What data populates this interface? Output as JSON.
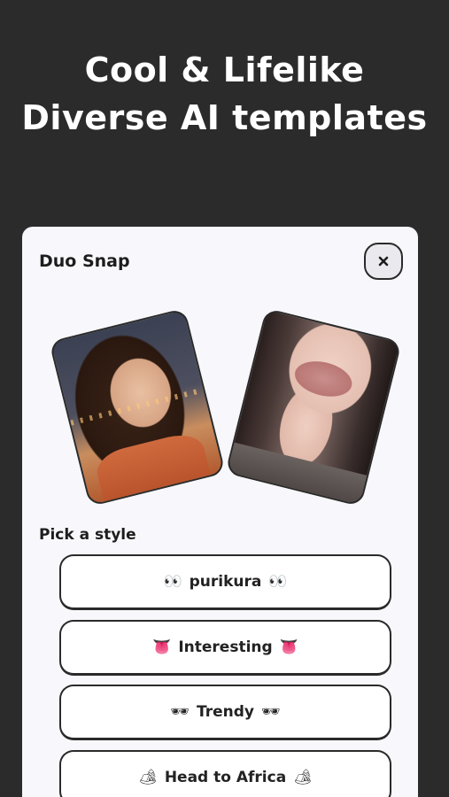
{
  "headline": {
    "line1": "Cool & Lifelike",
    "line2": "Diverse AI templates"
  },
  "sheet": {
    "title": "Duo Snap",
    "close_icon": "close-icon",
    "photos": [
      {
        "description_icon": "portrait-photo",
        "name": "photo-left"
      },
      {
        "description_icon": "portrait-photo",
        "name": "photo-right"
      }
    ],
    "section_label": "Pick a style",
    "styles": [
      {
        "emoji": "👀",
        "label": "purikura"
      },
      {
        "emoji": "👅",
        "label": "Interesting"
      },
      {
        "emoji": "🕶",
        "label": "Trendy"
      },
      {
        "emoji": "🏕",
        "label": "Head to Africa"
      }
    ]
  },
  "colors": {
    "background": "#2b2b2b",
    "sheet": "#f8f7fb",
    "border": "#2a2a2a",
    "text": "#1d1d1d"
  }
}
